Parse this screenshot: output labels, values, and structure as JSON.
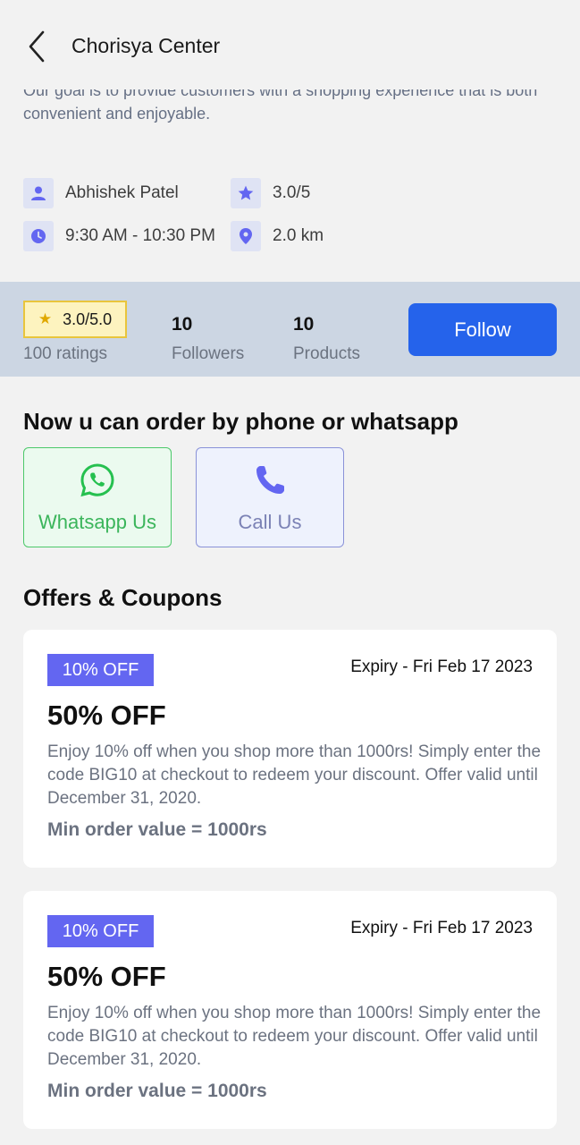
{
  "header": {
    "title": "Chorisya Center"
  },
  "store": {
    "description": "Our goal is to provide customers with a shopping experience that is both convenient and enjoyable.",
    "owner": "Abhishek Patel",
    "rating": "3.0/5",
    "hours": "9:30 AM - 10:30 PM",
    "distance": "2.0 km"
  },
  "stats": {
    "rating_badge": "3.0/5.0",
    "ratings_count": "100 ratings",
    "followers_value": "10",
    "followers_label": "Followers",
    "products_value": "10",
    "products_label": "Products",
    "follow_label": "Follow"
  },
  "order": {
    "heading": "Now u can order by phone or whatsapp",
    "whatsapp_label": "Whatsapp Us",
    "call_label": "Call Us"
  },
  "offers": {
    "heading": "Offers & Coupons",
    "items": [
      {
        "tag": "10% OFF",
        "expiry": "Expiry - Fri Feb 17 2023",
        "title": "50% OFF",
        "description": "Enjoy 10% off when you shop more than 1000rs! Simply enter the code BIG10 at checkout to redeem your discount. Offer valid until December 31, 2020.",
        "min_order": "Min order value = 1000rs"
      },
      {
        "tag": "10% OFF",
        "expiry": "Expiry - Fri Feb 17 2023",
        "title": "50% OFF",
        "description": "Enjoy 10% off when you shop more than 1000rs! Simply enter the code BIG10 at checkout to redeem your discount. Offer valid until December 31, 2020.",
        "min_order": "Min order value = 1000rs"
      }
    ]
  },
  "colors": {
    "accent": "#2563eb",
    "tag": "#6366f1",
    "icon": "#6366f1",
    "whatsapp": "#3bb55b",
    "star": "#e0a800"
  },
  "icons": [
    "back-arrow-icon",
    "person-icon",
    "star-icon",
    "clock-icon",
    "location-pin-icon",
    "whatsapp-icon",
    "phone-icon"
  ]
}
